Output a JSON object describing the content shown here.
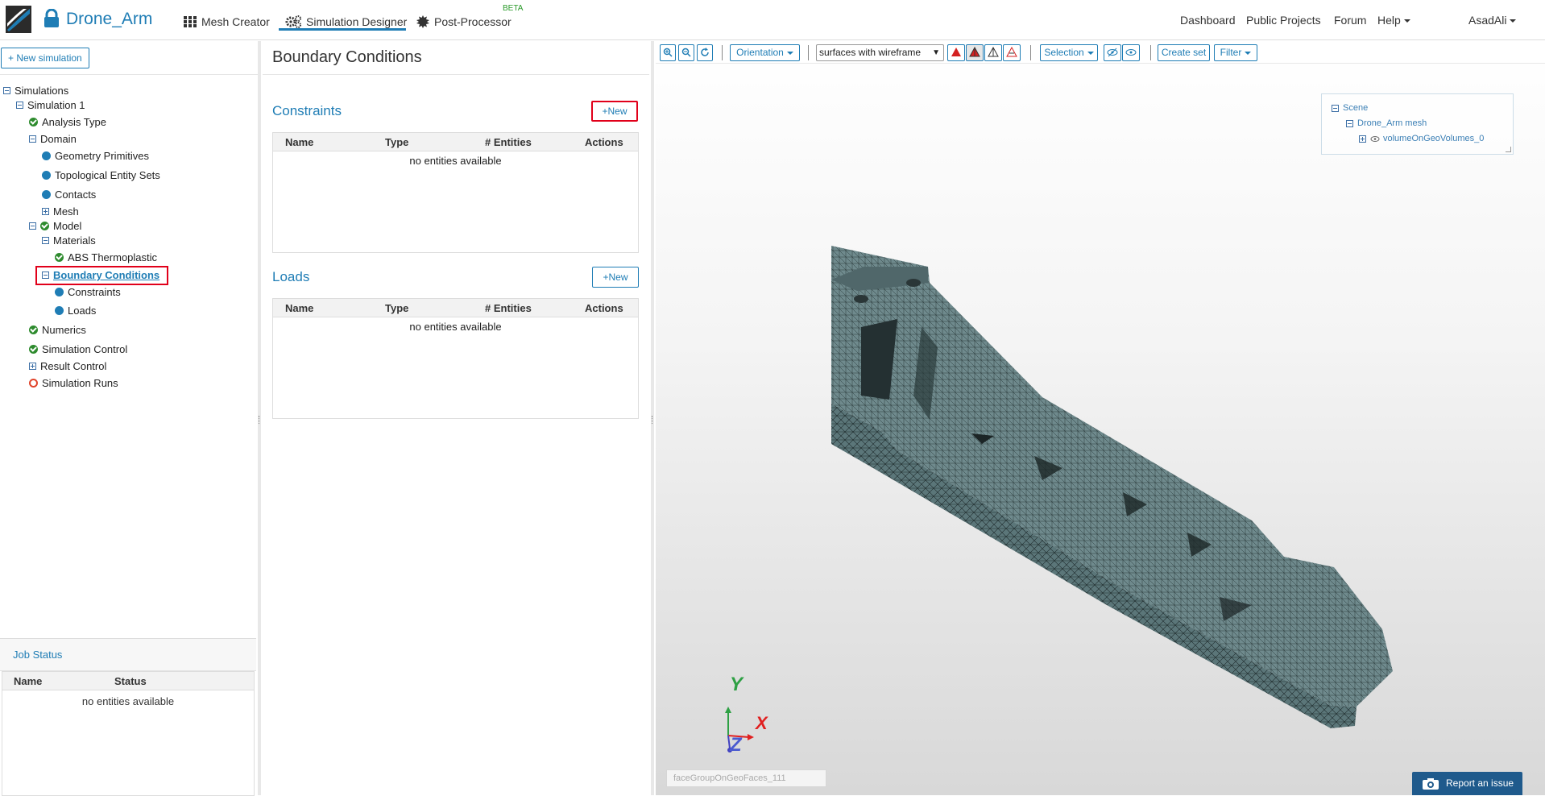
{
  "topbar": {
    "project_title": "Drone_Arm",
    "nav": {
      "mesh_creator": "Mesh Creator",
      "simulation_designer": "Simulation Designer",
      "post_processor": "Post-Processor",
      "beta": "BETA"
    },
    "right": {
      "dashboard": "Dashboard",
      "public_projects": "Public Projects",
      "forum": "Forum",
      "help": "Help",
      "user": "AsadAli"
    }
  },
  "sidebar": {
    "new_simulation": "New simulation",
    "tree": {
      "simulations": "Simulations",
      "simulation_1": "Simulation 1",
      "analysis_type": "Analysis Type",
      "domain": "Domain",
      "geometry_primitives": "Geometry Primitives",
      "topological_entity_sets": "Topological Entity Sets",
      "contacts": "Contacts",
      "mesh": "Mesh",
      "model": "Model",
      "materials": "Materials",
      "abs_thermoplastic": "ABS Thermoplastic",
      "boundary_conditions": "Boundary Conditions",
      "constraints": "Constraints",
      "loads": "Loads",
      "numerics": "Numerics",
      "simulation_control": "Simulation Control",
      "result_control": "Result Control",
      "simulation_runs": "Simulation Runs"
    }
  },
  "job_status": {
    "title": "Job Status",
    "columns": [
      "Name",
      "Status"
    ],
    "empty": "no entities available"
  },
  "main": {
    "title": "Boundary Conditions",
    "constraints": {
      "title": "Constraints",
      "new_label": "New",
      "columns": [
        "Name",
        "Type",
        "# Entities",
        "Actions"
      ],
      "empty": "no entities available"
    },
    "loads": {
      "title": "Loads",
      "new_label": "New",
      "columns": [
        "Name",
        "Type",
        "# Entities",
        "Actions"
      ],
      "empty": "no entities available"
    }
  },
  "viewer": {
    "toolbar": {
      "orientation": "Orientation",
      "render_mode": "surfaces with wireframe",
      "selection": "Selection",
      "create_set": "Create set",
      "filter": "Filter"
    },
    "scene_tree": {
      "scene": "Scene",
      "mesh": "Drone_Arm mesh",
      "volume": "volumeOnGeoVolumes_0"
    },
    "axes": {
      "y": "Y",
      "x": "X",
      "z": "Z"
    },
    "face_group_field": "faceGroupOnGeoFaces_111",
    "report_issue": "Report an issue"
  },
  "colors": {
    "accent": "#1f7db5",
    "highlight": "#e1001a",
    "check": "#2e8b2e",
    "mesh": "#4f6a6e"
  }
}
